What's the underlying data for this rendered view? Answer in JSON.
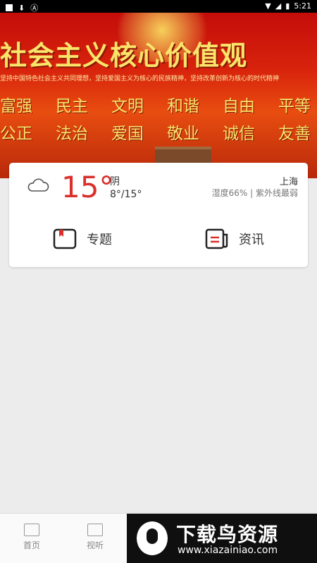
{
  "status_bar": {
    "time": "5:21"
  },
  "banner": {
    "title": "社会主义核心价值观",
    "subtitle": "坚持中国特色社会主义共同理想，坚持爱国主义为核心的民族精神，坚持改革创新为核心的时代精神",
    "row1": [
      "富强",
      "民主",
      "文明",
      "和谐",
      "自由",
      "平等"
    ],
    "row2": [
      "公正",
      "法治",
      "爱国",
      "敬业",
      "诚信",
      "友善"
    ]
  },
  "weather": {
    "temperature": "15°",
    "condition": "阴",
    "range": "8°/15°",
    "city": "上海",
    "details": "湿度66% | 紫外线最弱"
  },
  "features": {
    "topics": "专题",
    "news": "资讯"
  },
  "nav": {
    "home": "首页",
    "video": "视听"
  },
  "watermark": {
    "title": "下载鸟资源",
    "url": "www.xiazainiao.com"
  },
  "colors": {
    "accent": "#d9302c",
    "banner": "#d8240c"
  }
}
